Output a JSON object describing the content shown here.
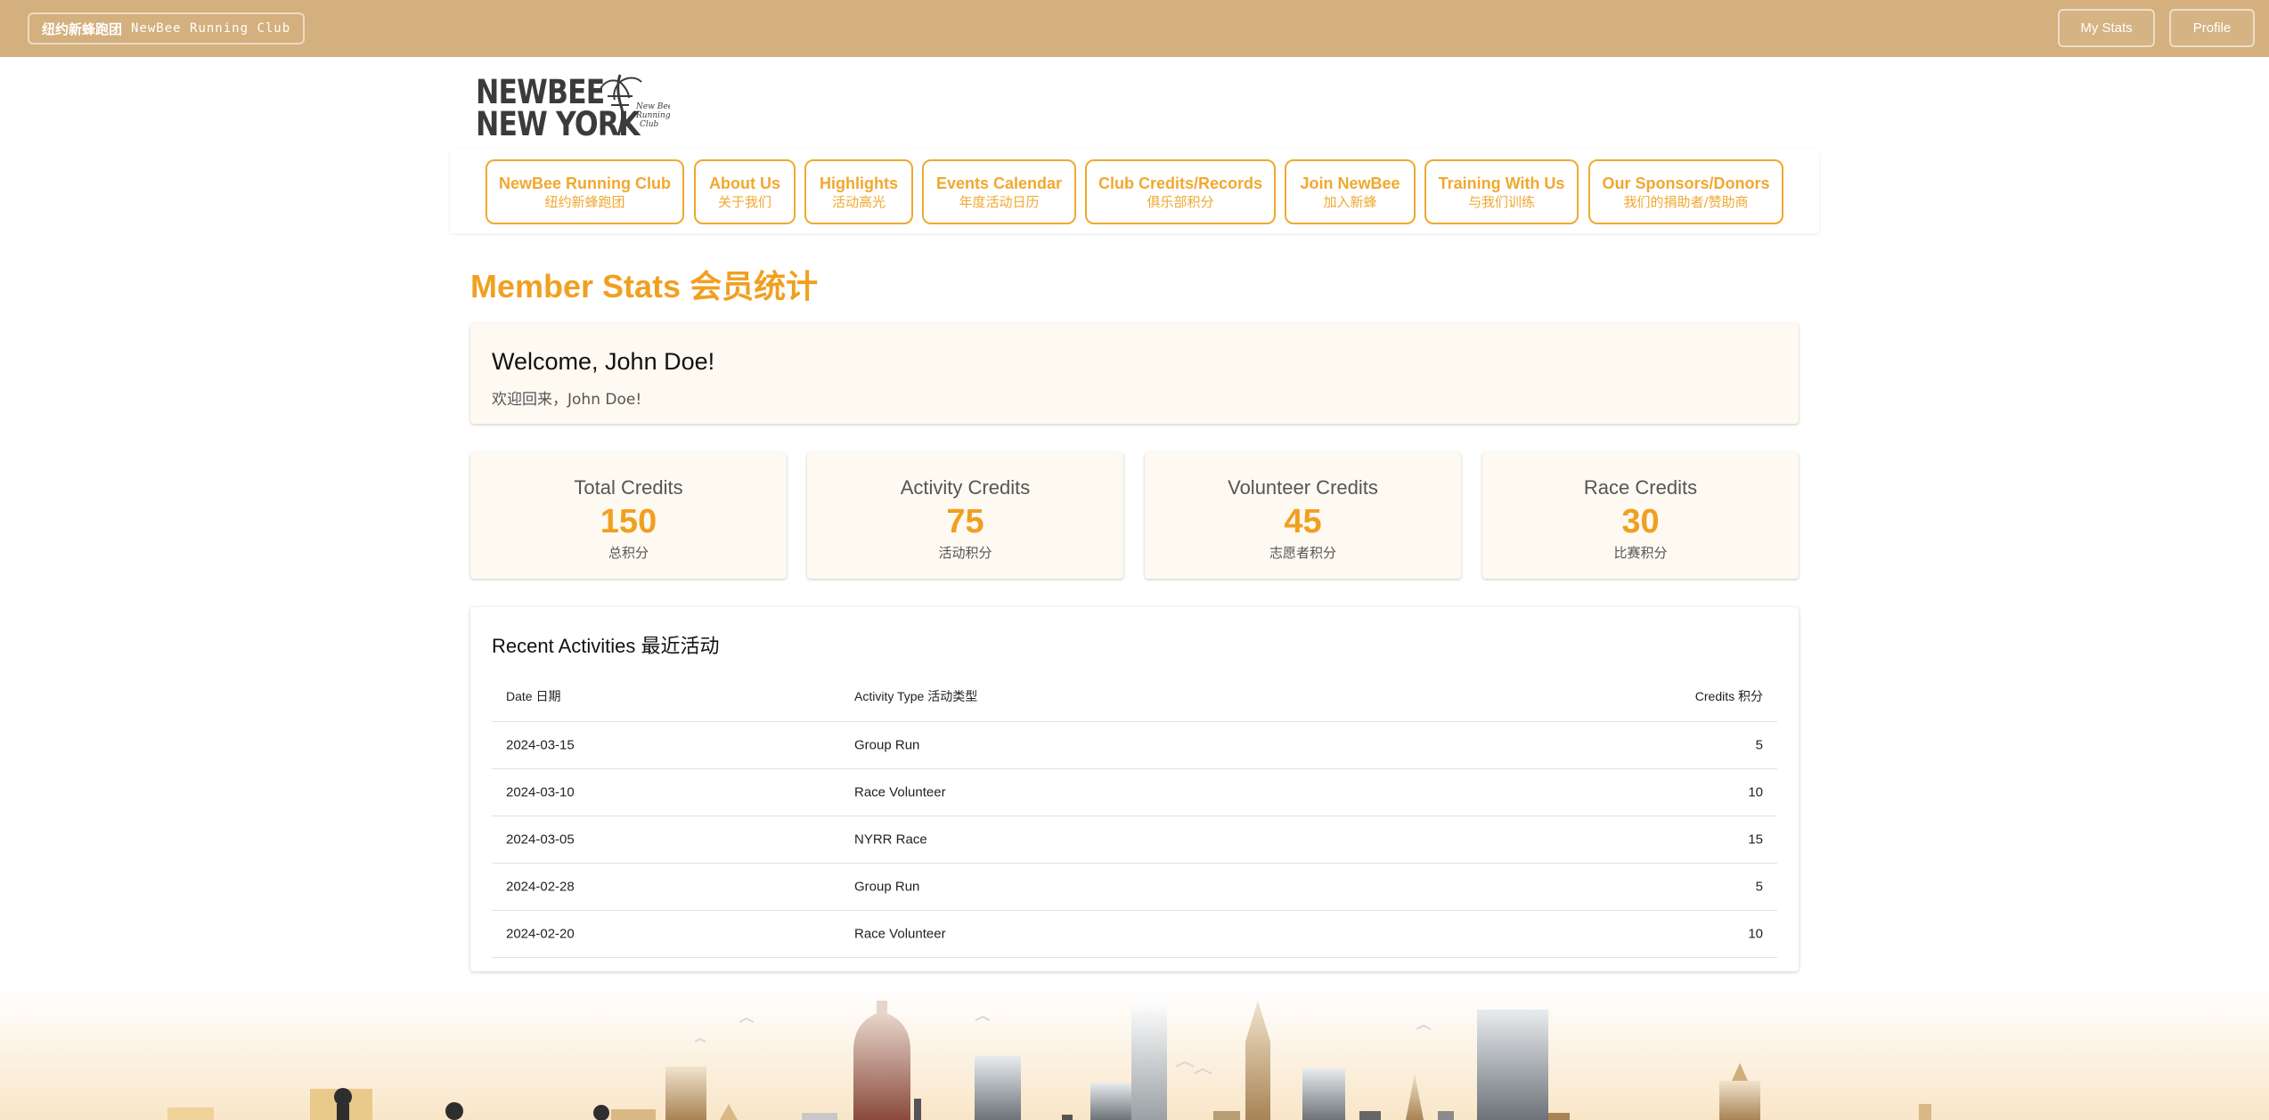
{
  "topbar": {
    "brand_zh": "纽约新蜂跑团",
    "brand_en": "NewBee Running Club",
    "my_stats": "My Stats",
    "profile": "Profile"
  },
  "logo": {
    "line1": "NEWBEE",
    "line2": "NEW YORK",
    "script": [
      "New Bee",
      "Running",
      "Club"
    ]
  },
  "nav": [
    {
      "en": "NewBee Running Club",
      "zh": "纽约新蜂跑团"
    },
    {
      "en": "About Us",
      "zh": "关于我们"
    },
    {
      "en": "Highlights",
      "zh": "活动高光"
    },
    {
      "en": "Events Calendar",
      "zh": "年度活动日历"
    },
    {
      "en": "Club Credits/Records",
      "zh": "俱乐部积分"
    },
    {
      "en": "Join NewBee",
      "zh": "加入新蜂"
    },
    {
      "en": "Training With Us",
      "zh": "与我们训练"
    },
    {
      "en": "Our Sponsors/Donors",
      "zh": "我们的捐助者/赞助商"
    }
  ],
  "page_title": "Member Stats 会员统计",
  "welcome": {
    "title": "Welcome, John Doe!",
    "subtitle": "欢迎回来，John Doe!"
  },
  "credits": [
    {
      "label": "Total Credits",
      "value": "150",
      "zh": "总积分"
    },
    {
      "label": "Activity Credits",
      "value": "75",
      "zh": "活动积分"
    },
    {
      "label": "Volunteer Credits",
      "value": "45",
      "zh": "志愿者积分"
    },
    {
      "label": "Race Credits",
      "value": "30",
      "zh": "比赛积分"
    }
  ],
  "activities": {
    "title": "Recent Activities 最近活动",
    "headers": [
      "Date 日期",
      "Activity Type 活动类型",
      "Credits 积分"
    ],
    "rows": [
      [
        "2024-03-15",
        "Group Run",
        "5"
      ],
      [
        "2024-03-10",
        "Race Volunteer",
        "10"
      ],
      [
        "2024-03-05",
        "NYRR Race",
        "15"
      ],
      [
        "2024-02-28",
        "Group Run",
        "5"
      ],
      [
        "2024-02-20",
        "Race Volunteer",
        "10"
      ]
    ]
  },
  "colors": {
    "topbar": "#d4b07e",
    "accent": "#f0a020",
    "card_bg": "#fef9f1"
  },
  "icons": {
    "logo_art": "palm-tree-bee-icon",
    "skyline": "nyc-skyline-illustration"
  }
}
